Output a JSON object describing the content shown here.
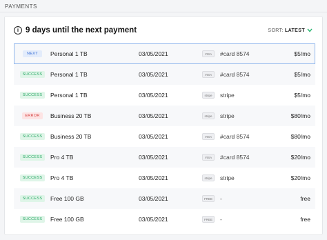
{
  "section_label": "PAYMENTS",
  "header": {
    "info_symbol": "i",
    "title": "9 days until the next payment",
    "sort_label": "SORT:",
    "sort_value": "LATEST"
  },
  "colors": {
    "next": "#3a6fd6",
    "success": "#2aa866",
    "error": "#d54545",
    "accent": "#2bb673"
  },
  "rows": [
    {
      "status": "NEXT",
      "kind": "next",
      "plan": "Personal 1 TB",
      "date": "03/05/2021",
      "method_icon": "VISA",
      "method": "#card 8574",
      "amount": "$5/mo"
    },
    {
      "status": "SUCCESS",
      "kind": "success",
      "plan": "Personal 1 TB",
      "date": "03/05/2021",
      "method_icon": "VISA",
      "method": "#card 8574",
      "amount": "$5/mo"
    },
    {
      "status": "SUCCESS",
      "kind": "success",
      "plan": "Personal 1 TB",
      "date": "03/05/2021",
      "method_icon": "stripe",
      "method": "stripe",
      "amount": "$5/mo"
    },
    {
      "status": "ERROR",
      "kind": "error",
      "plan": "Business 20 TB",
      "date": "03/05/2021",
      "method_icon": "stripe",
      "method": "stripe",
      "amount": "$80/mo"
    },
    {
      "status": "SUCCESS",
      "kind": "success",
      "plan": "Business 20 TB",
      "date": "03/05/2021",
      "method_icon": "VISA",
      "method": "#card 8574",
      "amount": "$80/mo"
    },
    {
      "status": "SUCCESS",
      "kind": "success",
      "plan": "Pro 4 TB",
      "date": "03/05/2021",
      "method_icon": "VISA",
      "method": "#card 8574",
      "amount": "$20/mo"
    },
    {
      "status": "SUCCESS",
      "kind": "success",
      "plan": "Pro 4 TB",
      "date": "03/05/2021",
      "method_icon": "stripe",
      "method": "stripe",
      "amount": "$20/mo"
    },
    {
      "status": "SUCCESS",
      "kind": "success",
      "plan": "Free 100 GB",
      "date": "03/05/2021",
      "method_icon": "FREE",
      "method": "-",
      "amount": "free"
    },
    {
      "status": "SUCCESS",
      "kind": "success",
      "plan": "Free 100 GB",
      "date": "03/05/2021",
      "method_icon": "FREE",
      "method": "-",
      "amount": "free"
    }
  ]
}
